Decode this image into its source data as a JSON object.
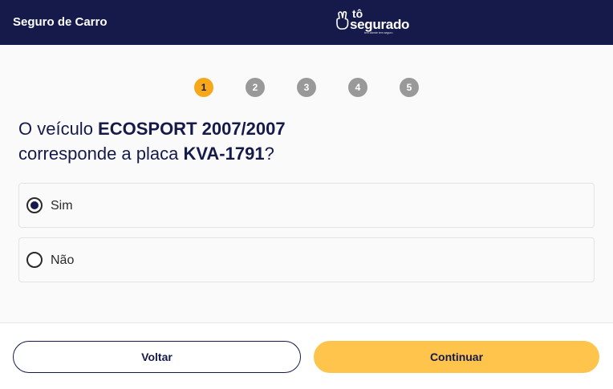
{
  "header": {
    "title": "Seguro de Carro",
    "logo": {
      "line1": "tô",
      "line2": "segurado",
      "tagline": "tem cliente tem seguro"
    }
  },
  "stepper": {
    "steps": [
      "1",
      "2",
      "3",
      "4",
      "5"
    ],
    "active_step": 1
  },
  "question": {
    "prefix": "O veículo ",
    "vehicle": "ECOSPORT 2007/2007",
    "middle": "corresponde a placa ",
    "plate": "KVA-1791",
    "suffix": "?"
  },
  "options": [
    {
      "label": "Sim",
      "selected": true
    },
    {
      "label": "Não",
      "selected": false
    }
  ],
  "footer": {
    "back_label": "Voltar",
    "next_label": "Continuar"
  },
  "colors": {
    "header_bg": "#151a4b",
    "accent": "#f6a81a",
    "button_primary": "#ffc44c",
    "step_inactive": "#999999"
  }
}
